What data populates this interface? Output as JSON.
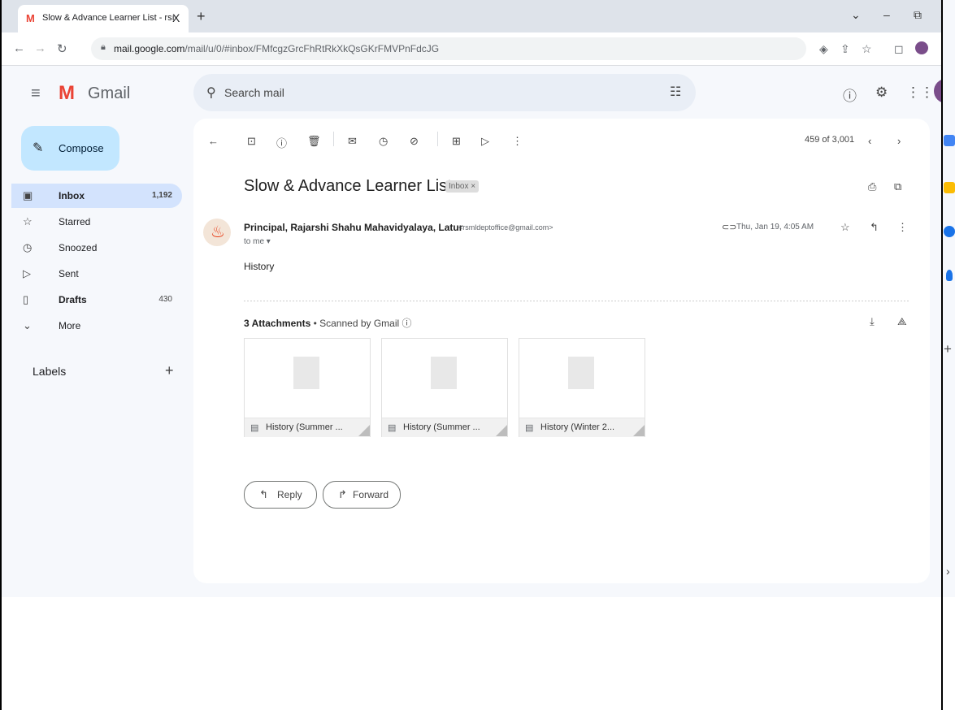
{
  "browser": {
    "tab_favicon": "M",
    "tab_title": "Slow & Advance Learner List - rsı",
    "tab_close": "X",
    "new_tab": "+",
    "url_host": "mail.google.com",
    "url_path": "/mail/u/0/#inbox/FMfcgzGrcFhRtRkXkQsGKrFMVPnFdcJG"
  },
  "gmail": {
    "logo_text": "Gmail",
    "search_placeholder": "Search mail",
    "compose_label": "Compose"
  },
  "sidebar": {
    "items": [
      {
        "label": "Inbox",
        "count": "1,192"
      },
      {
        "label": "Starred",
        "count": ""
      },
      {
        "label": "Snoozed",
        "count": ""
      },
      {
        "label": "Sent",
        "count": ""
      },
      {
        "label": "Drafts",
        "count": "430"
      },
      {
        "label": "More",
        "count": ""
      }
    ],
    "labels_heading": "Labels"
  },
  "toolbar": {
    "pager": "459 of 3,001"
  },
  "message": {
    "subject": "Slow & Advance Learner List",
    "label_chip": "Inbox ×",
    "sender_name": "Principal, Rajarshi Shahu Mahavidyalaya, Latur",
    "sender_email": "<rsmldeptoffice@gmail.com>",
    "to": "to me ▾",
    "date": "Thu, Jan 19, 4:05 AM",
    "body": "History",
    "attachments_count": "3 Attachments",
    "scanned": " • Scanned by Gmail ⓘ",
    "attachments": [
      {
        "name": "History (Summer ..."
      },
      {
        "name": "History (Summer ..."
      },
      {
        "name": "History (Winter 2..."
      }
    ],
    "reply_label": "Reply",
    "forward_label": "Forward"
  },
  "icons": [
    "gmail-icon",
    "back-icon",
    "forward-icon",
    "reload-icon",
    "lock-icon",
    "menu-icon",
    "search-icon",
    "tune-icon",
    "help-icon",
    "settings-icon",
    "apps-icon",
    "archive-icon",
    "report-icon",
    "delete-icon",
    "mail-icon",
    "snooze-icon",
    "task-icon",
    "move-icon",
    "label-icon",
    "more-icon",
    "print-icon",
    "open-new-icon",
    "attachment-icon",
    "star-icon",
    "reply-icon",
    "download-icon",
    "drive-icon"
  ],
  "colors": {
    "accent": "#c2e7ff",
    "active_nav": "#d3e3fd",
    "gmail_red": "#ea4335"
  }
}
